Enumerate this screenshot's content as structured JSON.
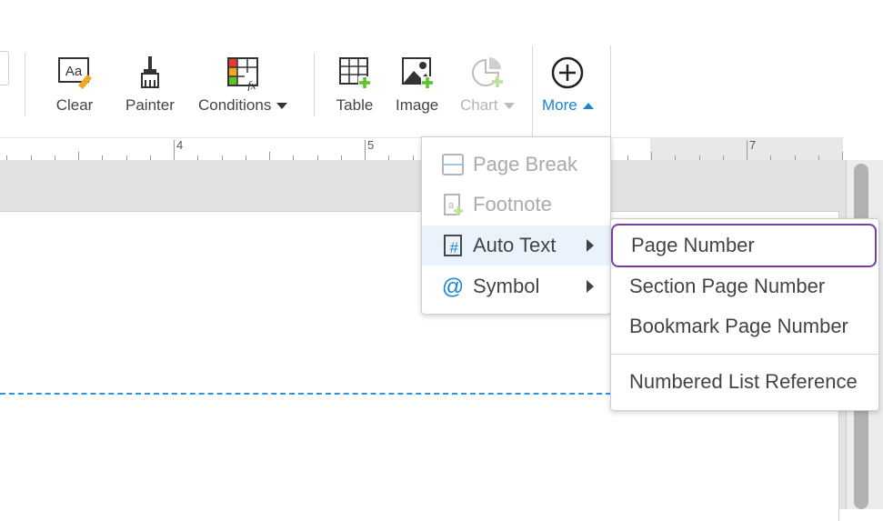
{
  "toolbar": {
    "clear_label": "Clear",
    "painter_label": "Painter",
    "conditions_label": "Conditions",
    "table_label": "Table",
    "image_label": "Image",
    "chart_label": "Chart",
    "more_label": "More"
  },
  "ruler": {
    "labels": [
      "4",
      "5",
      "7"
    ]
  },
  "more_menu": {
    "items": [
      {
        "label": "Page Break",
        "enabled": false,
        "icon": "page-break-icon"
      },
      {
        "label": "Footnote",
        "enabled": false,
        "icon": "footnote-icon"
      },
      {
        "label": "Auto Text",
        "enabled": true,
        "icon": "auto-text-icon",
        "submenu": true,
        "highlighted": true
      },
      {
        "label": "Symbol",
        "enabled": true,
        "icon": "at-sign-icon",
        "submenu": true
      }
    ]
  },
  "auto_text_submenu": {
    "items": [
      {
        "label": "Page Number",
        "focused": true
      },
      {
        "label": "Section Page Number"
      },
      {
        "label": "Bookmark Page Number"
      },
      {
        "label": "Numbered List Reference"
      }
    ]
  },
  "colors": {
    "accent": "#1a85d6",
    "focus_outline": "#7a3e9d",
    "page_break_guide": "#2a93e0",
    "add_green": "#5cc12a"
  }
}
